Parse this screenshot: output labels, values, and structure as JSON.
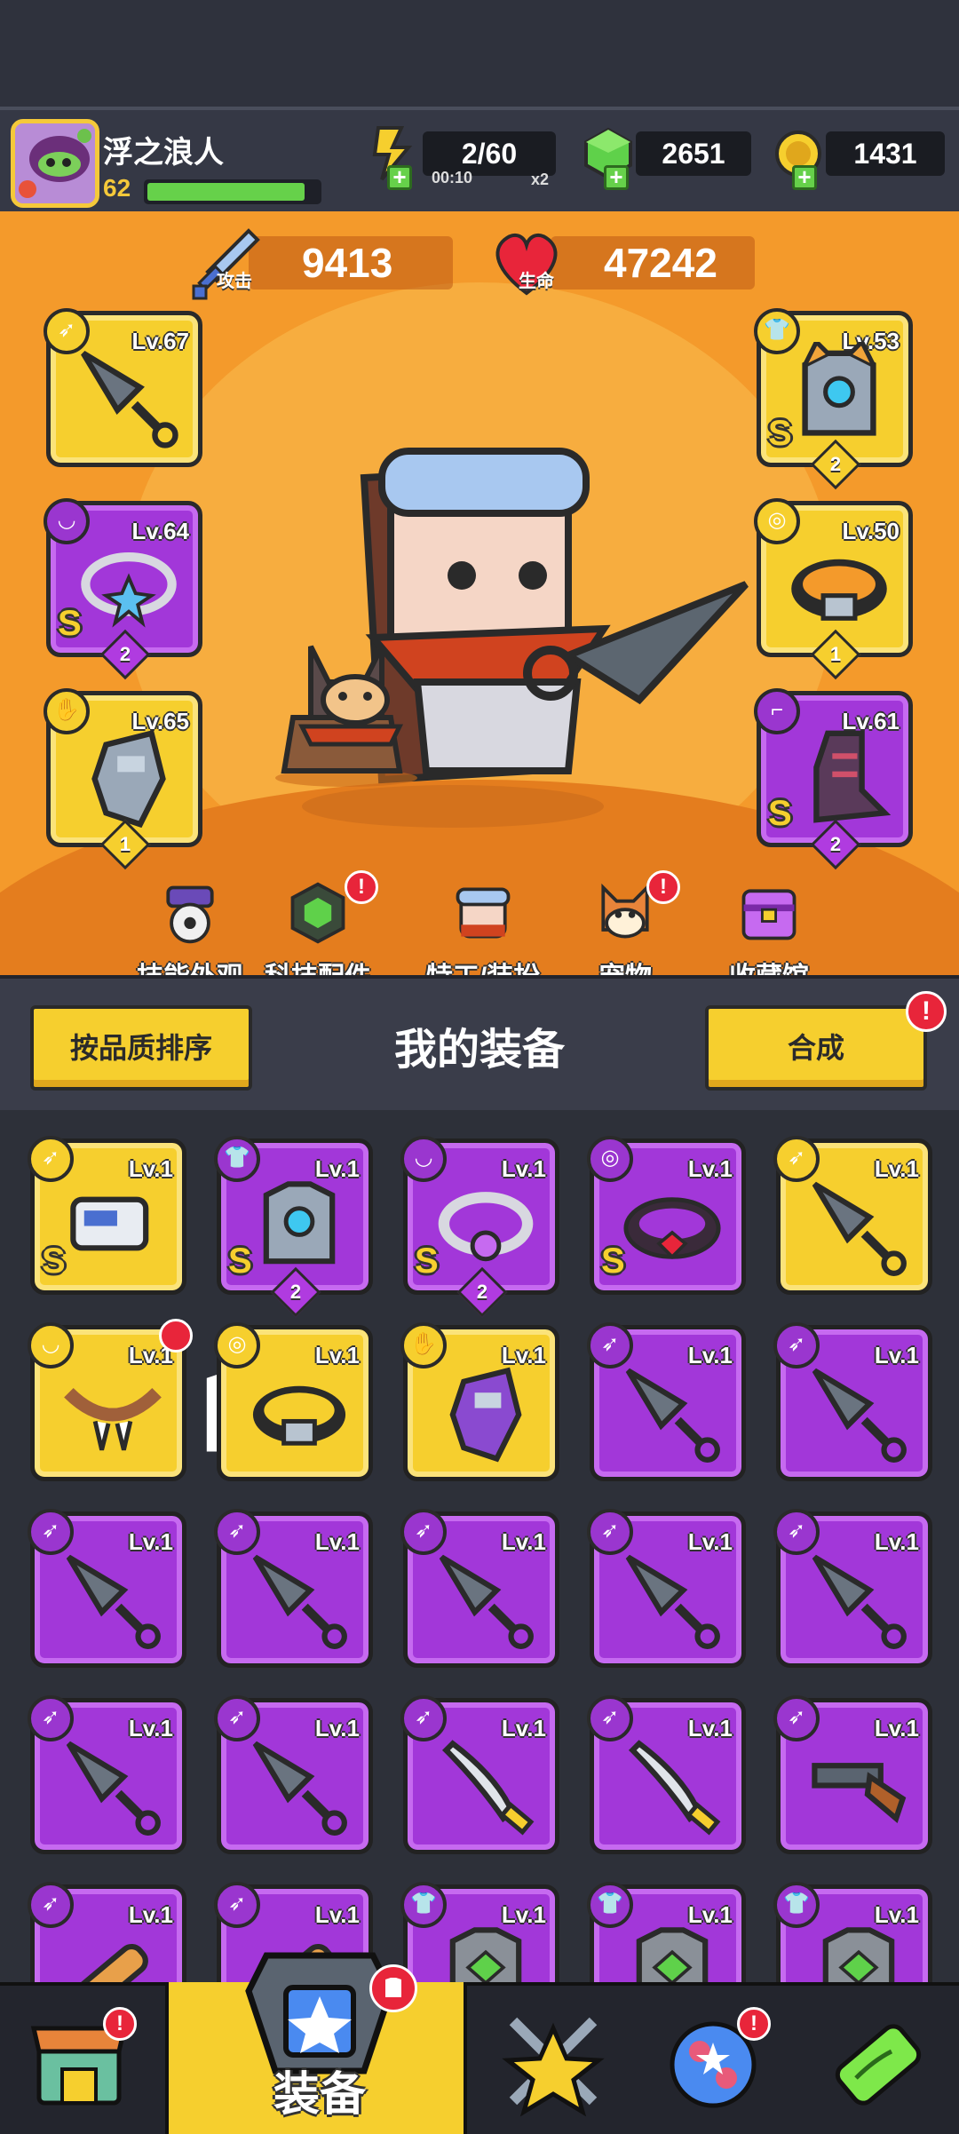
{
  "player": {
    "name": "浮之浪人",
    "level": "62",
    "xp_fraction": 0.92
  },
  "resources": {
    "energy": {
      "value": "2/60",
      "timer": "00:10",
      "multiplier": "x2",
      "icon": "energy-bolt-icon"
    },
    "gems": {
      "value": "2651",
      "icon": "green-gem-icon"
    },
    "coins": {
      "value": "1431",
      "icon": "gold-coin-icon"
    },
    "plus_glyph": "+"
  },
  "stats": {
    "attack": {
      "label": "攻击",
      "value": "9413",
      "icon": "sword-icon"
    },
    "health": {
      "label": "生命",
      "value": "47242",
      "icon": "heart-icon"
    }
  },
  "equipped": {
    "weapon": {
      "level": "Lv.67",
      "rarity_color": "yellow",
      "type_icon": "weapon-slot-icon",
      "item_icon": "kunai-icon"
    },
    "necklace": {
      "level": "Lv.64",
      "rarity_color": "purple",
      "s_mark": "S",
      "stars": "2",
      "type_icon": "necklace-slot-icon",
      "item_icon": "star-necklace-icon"
    },
    "gloves": {
      "level": "Lv.65",
      "rarity_color": "yellow",
      "stars": "1",
      "type_icon": "gloves-slot-icon",
      "item_icon": "gauntlet-icon"
    },
    "armor": {
      "level": "Lv.53",
      "rarity_color": "yellow",
      "s_mark": "S",
      "stars": "2",
      "type_icon": "armor-slot-icon",
      "item_icon": "mech-armor-icon"
    },
    "belt": {
      "level": "Lv.50",
      "rarity_color": "yellow",
      "stars": "1",
      "type_icon": "belt-slot-icon",
      "item_icon": "belt-icon"
    },
    "boots": {
      "level": "Lv.61",
      "rarity_color": "purple",
      "s_mark": "S",
      "stars": "2",
      "type_icon": "boots-slot-icon",
      "item_icon": "boots-icon"
    }
  },
  "hero_menu": [
    {
      "label": "技能外观",
      "icon": "skill-skin-icon",
      "alert": ""
    },
    {
      "label": "科技配件",
      "icon": "tech-part-icon",
      "alert": "!"
    },
    {
      "label": "特工/装扮",
      "icon": "agent-costume-icon",
      "alert": ""
    },
    {
      "label": "宠物",
      "icon": "pet-dog-icon",
      "alert": "!"
    },
    {
      "label": "收藏馆",
      "icon": "collection-chest-icon",
      "alert": ""
    }
  ],
  "equipment_panel": {
    "sort_label": "按品质排序",
    "title": "我的装备",
    "merge_label": "合成",
    "merge_alert": "!"
  },
  "inventory": [
    {
      "level": "Lv.1",
      "rarity_color": "yellow",
      "s_mark": "S",
      "stars": "",
      "item_icon": "gun-gauntlet-icon"
    },
    {
      "level": "Lv.1",
      "rarity_color": "purple",
      "s_mark": "S",
      "stars": "2",
      "item_icon": "mech-armor-icon"
    },
    {
      "level": "Lv.1",
      "rarity_color": "purple",
      "s_mark": "S",
      "stars": "2",
      "item_icon": "orb-necklace-icon"
    },
    {
      "level": "Lv.1",
      "rarity_color": "purple",
      "s_mark": "S",
      "stars": "",
      "item_icon": "ruby-belt-icon"
    },
    {
      "level": "Lv.1",
      "rarity_color": "yellow",
      "s_mark": "",
      "stars": "",
      "item_icon": "kunai-icon"
    },
    {
      "level": "Lv.1",
      "rarity_color": "yellow",
      "s_mark": "",
      "stars": "",
      "item_icon": "fang-necklace-icon",
      "new_badge": true
    },
    {
      "level": "Lv.1",
      "rarity_color": "yellow",
      "s_mark": "",
      "stars": "",
      "item_icon": "belt-icon"
    },
    {
      "level": "Lv.1",
      "rarity_color": "yellow",
      "s_mark": "",
      "stars": "",
      "item_icon": "gauntlet-icon"
    },
    {
      "level": "Lv.1",
      "rarity_color": "purple",
      "s_mark": "",
      "stars": "",
      "item_icon": "kunai-icon"
    },
    {
      "level": "Lv.1",
      "rarity_color": "purple",
      "s_mark": "",
      "stars": "",
      "item_icon": "kunai-icon"
    },
    {
      "level": "Lv.1",
      "rarity_color": "purple",
      "s_mark": "",
      "stars": "",
      "item_icon": "kunai-icon"
    },
    {
      "level": "Lv.1",
      "rarity_color": "purple",
      "s_mark": "",
      "stars": "",
      "item_icon": "kunai-icon"
    },
    {
      "level": "Lv.1",
      "rarity_color": "purple",
      "s_mark": "",
      "stars": "",
      "item_icon": "kunai-icon"
    },
    {
      "level": "Lv.1",
      "rarity_color": "purple",
      "s_mark": "",
      "stars": "",
      "item_icon": "kunai-icon"
    },
    {
      "level": "Lv.1",
      "rarity_color": "purple",
      "s_mark": "",
      "stars": "",
      "item_icon": "kunai-icon"
    },
    {
      "level": "Lv.1",
      "rarity_color": "purple",
      "s_mark": "",
      "stars": "",
      "item_icon": "kunai-icon"
    },
    {
      "level": "Lv.1",
      "rarity_color": "purple",
      "s_mark": "",
      "stars": "",
      "item_icon": "kunai-icon"
    },
    {
      "level": "Lv.1",
      "rarity_color": "purple",
      "s_mark": "",
      "stars": "",
      "item_icon": "katana-icon"
    },
    {
      "level": "Lv.1",
      "rarity_color": "purple",
      "s_mark": "",
      "stars": "",
      "item_icon": "katana-icon"
    },
    {
      "level": "Lv.1",
      "rarity_color": "purple",
      "s_mark": "",
      "stars": "",
      "item_icon": "shotgun-icon"
    },
    {
      "level": "Lv.1",
      "rarity_color": "purple",
      "s_mark": "",
      "stars": "",
      "item_icon": "club-icon"
    },
    {
      "level": "Lv.1",
      "rarity_color": "purple",
      "s_mark": "",
      "stars": "",
      "item_icon": "club-icon"
    },
    {
      "level": "Lv.1",
      "rarity_color": "purple",
      "s_mark": "",
      "stars": "",
      "item_icon": "vest-icon"
    },
    {
      "level": "Lv.1",
      "rarity_color": "purple",
      "s_mark": "",
      "stars": "",
      "item_icon": "vest-icon"
    },
    {
      "level": "Lv.1",
      "rarity_color": "purple",
      "s_mark": "",
      "stars": "",
      "item_icon": "vest-icon"
    }
  ],
  "bottom_nav": [
    {
      "label": "",
      "icon": "shop-icon",
      "alert": "!"
    },
    {
      "label": "装备",
      "icon": "equipment-icon",
      "alert": "",
      "active": true
    },
    {
      "label": "",
      "icon": "star-battle-icon",
      "alert": ""
    },
    {
      "label": "",
      "icon": "planet-icon",
      "alert": "!"
    },
    {
      "label": "",
      "icon": "dna-capsule-icon",
      "alert": ""
    }
  ],
  "colors": {
    "rarity_yellow": "#f6cf2e",
    "rarity_purple": "#a237d9",
    "hero_bg": "#f49a2b",
    "alert_red": "#e8253a"
  }
}
